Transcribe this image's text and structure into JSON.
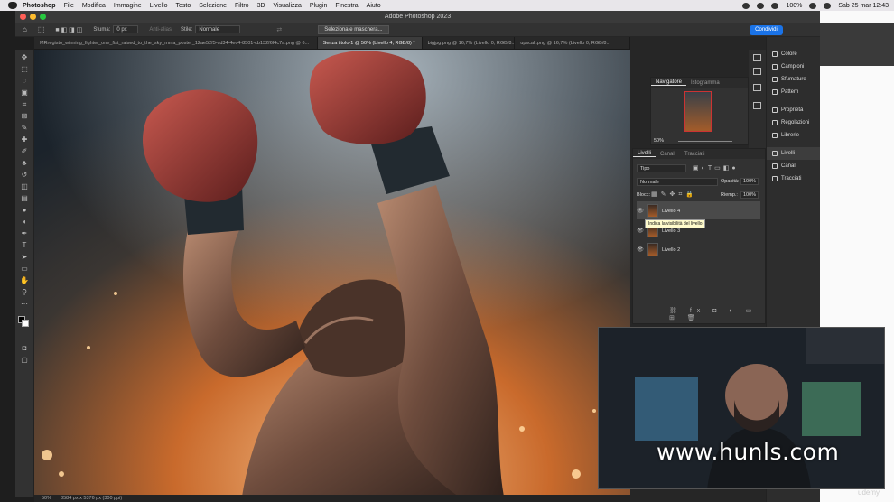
{
  "menubar": {
    "items": [
      "Photoshop",
      "File",
      "Modifica",
      "Immagine",
      "Livello",
      "Testo",
      "Selezione",
      "Filtro",
      "3D",
      "Visualizza",
      "Plugin",
      "Finestra",
      "Aiuto"
    ],
    "battery": "100%",
    "datetime": "Sab 25 mar  12:43"
  },
  "window": {
    "title": "Adobe Photoshop 2023"
  },
  "options": {
    "feather_label": "Sfuma:",
    "feather_value": "0 px",
    "antialias": "Anti-alias",
    "style_label": "Stile:",
    "style_value": "Normale",
    "mask_button": "Seleziona e maschera...",
    "share_button": "Condividi"
  },
  "tabs": [
    "MRregisto_winning_fighter_one_fist_raised_to_the_sky_mma_poster_12ae52f5-cd34-4ec4-8501-cb132f6f4c7a.png @ 6...",
    "Senza titolo-1 @ 50% (Livello 4, RGB/8) *",
    "bigjpg.png @ 16,7% (Livello 0, RGB/8...",
    "upscali.png @ 16,7% (Livello 0, RGB/8..."
  ],
  "status": {
    "zoom": "50%",
    "size": "3584 px x 5376 px (300 ppi)"
  },
  "navigator": {
    "tabs": [
      "Navigatore",
      "Istogramma"
    ],
    "zoom": "50%"
  },
  "layers_panel": {
    "tabs": [
      "Livelli",
      "Canali",
      "Tracciati"
    ],
    "filter": "Tipo",
    "blend": "Normale",
    "opacity_label": "Opacità:",
    "opacity": "100%",
    "lock_label": "Blocc:",
    "fill_label": "Riemp.:",
    "fill": "100%",
    "layers": [
      "Livello 4",
      "Livello 3",
      "Livello 2"
    ],
    "tooltip": "Indica la visibilità del livello"
  },
  "panel_list": [
    "Colore",
    "Campioni",
    "Sfumature",
    "Pattern",
    "Proprietà",
    "Regolazioni",
    "Librerie",
    "Livelli",
    "Canali",
    "Tracciati"
  ],
  "watermark": "www.hunls.com",
  "udemy": "udemy"
}
